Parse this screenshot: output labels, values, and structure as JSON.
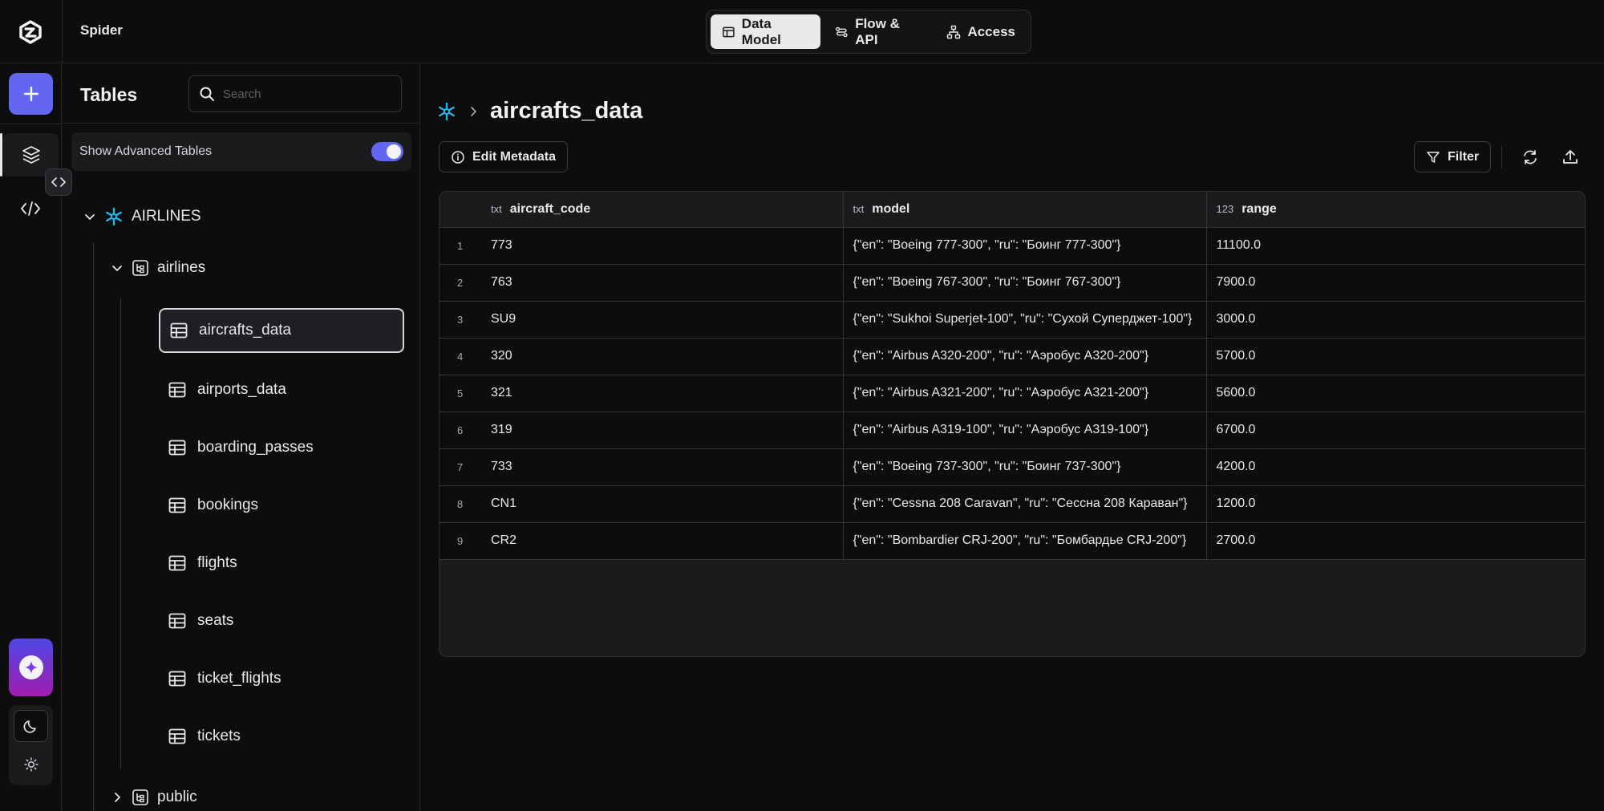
{
  "app": {
    "name": "Spider"
  },
  "nav": {
    "tabs": [
      {
        "label": "Data Model",
        "icon": "table-icon",
        "active": true
      },
      {
        "label": "Flow & API",
        "icon": "flow-icon",
        "active": false
      },
      {
        "label": "Access",
        "icon": "network-icon",
        "active": false
      }
    ]
  },
  "sidebar": {
    "title": "Tables",
    "search_placeholder": "Search",
    "advanced_label": "Show Advanced Tables",
    "advanced_enabled": true,
    "database": "AIRLINES",
    "schemas": [
      {
        "name": "airlines",
        "expanded": true,
        "tables": [
          "aircrafts_data",
          "airports_data",
          "boarding_passes",
          "bookings",
          "flights",
          "seats",
          "ticket_flights",
          "tickets"
        ]
      },
      {
        "name": "public",
        "expanded": false
      }
    ],
    "selected_table": "aircrafts_data"
  },
  "main": {
    "title": "aircrafts_data",
    "edit_metadata_label": "Edit Metadata",
    "filter_label": "Filter",
    "columns": [
      {
        "type": "txt",
        "name": "aircraft_code"
      },
      {
        "type": "txt",
        "name": "model"
      },
      {
        "type": "123",
        "name": "range"
      }
    ],
    "rows": [
      {
        "n": "1",
        "aircraft_code": "773",
        "model": "{\"en\": \"Boeing 777-300\", \"ru\": \"Боинг 777-300\"}",
        "range": "11100.0"
      },
      {
        "n": "2",
        "aircraft_code": "763",
        "model": "{\"en\": \"Boeing 767-300\", \"ru\": \"Боинг 767-300\"}",
        "range": "7900.0"
      },
      {
        "n": "3",
        "aircraft_code": "SU9",
        "model": "{\"en\": \"Sukhoi Superjet-100\", \"ru\": \"Сухой Суперджет-100\"}",
        "range": "3000.0"
      },
      {
        "n": "4",
        "aircraft_code": "320",
        "model": "{\"en\": \"Airbus A320-200\", \"ru\": \"Аэробус A320-200\"}",
        "range": "5700.0"
      },
      {
        "n": "5",
        "aircraft_code": "321",
        "model": "{\"en\": \"Airbus A321-200\", \"ru\": \"Аэробус A321-200\"}",
        "range": "5600.0"
      },
      {
        "n": "6",
        "aircraft_code": "319",
        "model": "{\"en\": \"Airbus A319-100\", \"ru\": \"Аэробус A319-100\"}",
        "range": "6700.0"
      },
      {
        "n": "7",
        "aircraft_code": "733",
        "model": "{\"en\": \"Boeing 737-300\", \"ru\": \"Боинг 737-300\"}",
        "range": "4200.0"
      },
      {
        "n": "8",
        "aircraft_code": "CN1",
        "model": "{\"en\": \"Cessna 208 Caravan\", \"ru\": \"Сессна 208 Караван\"}",
        "range": "1200.0"
      },
      {
        "n": "9",
        "aircraft_code": "CR2",
        "model": "{\"en\": \"Bombardier CRJ-200\", \"ru\": \"Бомбардье CRJ-200\"}",
        "range": "2700.0"
      }
    ]
  },
  "colors": {
    "accent": "#6366f1",
    "snowflake": "#29b5e8",
    "background": "#0d0d0e"
  }
}
